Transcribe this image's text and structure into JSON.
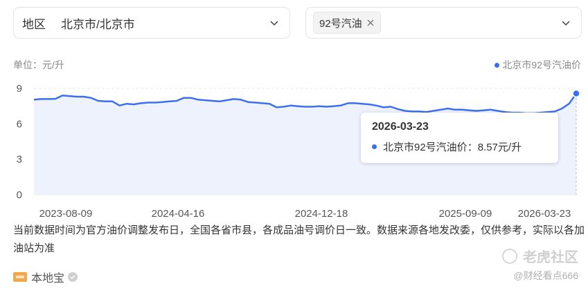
{
  "filters": {
    "region_label": "地区",
    "region_value": "北京市/北京市",
    "fuel_tag": "92号汽油"
  },
  "chart_header": {
    "unit": "单位：元/升",
    "legend": "北京市92号汽油价"
  },
  "tooltip": {
    "date": "2026-03-23",
    "series": "北京市92号汽油价",
    "separator": "：",
    "value": "8.57元/升"
  },
  "note": "当前数据时间为官方油价调整发布日，全国各省市县，各成品油号调价日一致。数据来源各地发改委，仅供参考，实际以各加油站为准",
  "brand": "本地宝",
  "watermark": "老虎社区",
  "watermark_author": "@财经看点666",
  "colors": {
    "line": "#3b6ff0",
    "area": "#eef2fd",
    "grid": "#e8e8e8"
  },
  "chart_data": {
    "type": "area",
    "title": "",
    "ylabel": "单位：元/升",
    "ylim": [
      0,
      9
    ],
    "yticks": [
      0,
      3,
      6,
      9
    ],
    "xticks": [
      "2023-08-09",
      "2024-04-16",
      "2024-12-18",
      "2025-09-09",
      "2026-03-23"
    ],
    "grid": true,
    "legend_position": "top-right",
    "series": [
      {
        "name": "北京市92号汽油价",
        "values": [
          8.05,
          8.1,
          8.1,
          8.12,
          8.4,
          8.35,
          8.3,
          8.3,
          8.2,
          7.95,
          7.9,
          7.9,
          7.55,
          7.7,
          7.65,
          7.75,
          7.8,
          7.8,
          7.85,
          7.9,
          7.95,
          8.2,
          8.2,
          8.05,
          8.0,
          7.95,
          7.9,
          8.0,
          8.1,
          8.05,
          7.85,
          7.8,
          7.75,
          7.7,
          7.4,
          7.45,
          7.55,
          7.5,
          7.45,
          7.45,
          7.5,
          7.45,
          7.5,
          7.55,
          7.75,
          7.75,
          7.7,
          7.65,
          7.55,
          7.4,
          7.45,
          7.25,
          7.1,
          7.05,
          7.05,
          7.0,
          7.1,
          7.2,
          7.3,
          7.2,
          7.2,
          7.15,
          7.1,
          7.15,
          7.2,
          7.1,
          7.0,
          6.95,
          6.95,
          6.9,
          6.9,
          6.95,
          7.0,
          7.05,
          7.3,
          7.7,
          8.57
        ]
      }
    ],
    "last_point": {
      "x": "2026-03-23",
      "y": 8.57
    }
  }
}
